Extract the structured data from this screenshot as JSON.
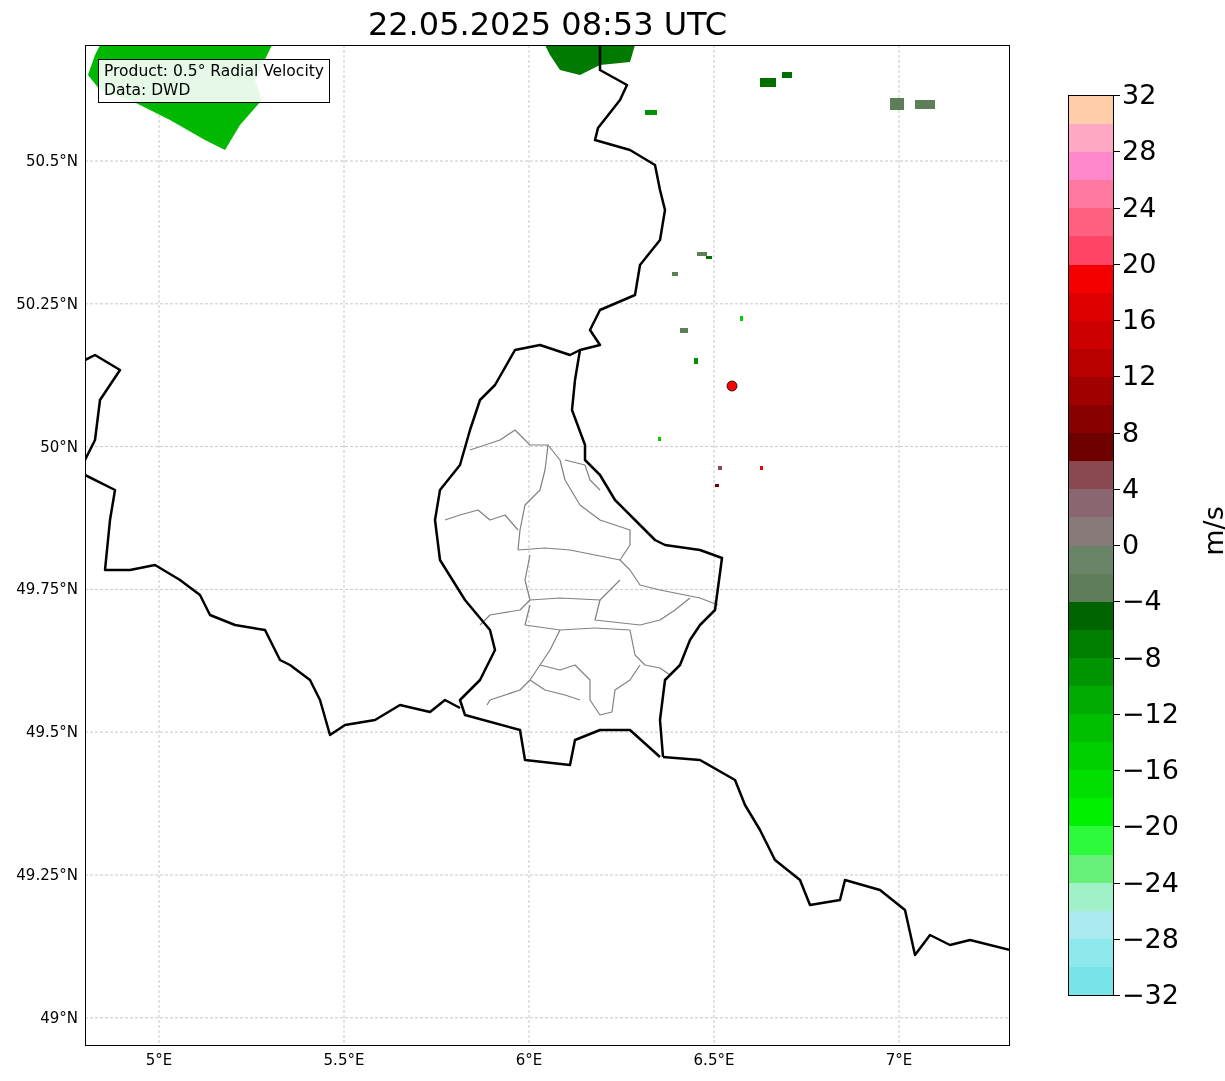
{
  "title": "22.05.2025 08:53 UTC",
  "info_box": {
    "lines": [
      "Product: 0.5° Radial Velocity",
      "Data: DWD"
    ]
  },
  "map": {
    "longitude_ticks": [
      "5°E",
      "5.5°E",
      "6°E",
      "6.5°E",
      "7°E"
    ],
    "latitude_ticks": [
      "50.5°N",
      "50.25°N",
      "50°N",
      "49.75°N",
      "49.5°N",
      "49.25°N",
      "49°N"
    ]
  },
  "colorbar": {
    "label": "m/s",
    "ticks": [
      "32",
      "28",
      "24",
      "20",
      "16",
      "12",
      "8",
      "4",
      "0",
      "−4",
      "−8",
      "−12",
      "−16",
      "−20",
      "−24",
      "−28",
      "−32"
    ],
    "bins": [
      {
        "color": "#ffcdaa"
      },
      {
        "color": "#ffa8c4"
      },
      {
        "color": "#ff88cc"
      },
      {
        "color": "#ff78a0"
      },
      {
        "color": "#ff6080"
      },
      {
        "color": "#ff4466"
      },
      {
        "color": "#f50000"
      },
      {
        "color": "#de0000"
      },
      {
        "color": "#cc0000"
      },
      {
        "color": "#b80000"
      },
      {
        "color": "#a00000"
      },
      {
        "color": "#880000"
      },
      {
        "color": "#6e0000"
      },
      {
        "color": "#8a4850"
      },
      {
        "color": "#8a6670"
      },
      {
        "color": "#887a78"
      },
      {
        "color": "#6a8468"
      },
      {
        "color": "#5e7e5a"
      },
      {
        "color": "#006400"
      },
      {
        "color": "#007e00"
      },
      {
        "color": "#009400"
      },
      {
        "color": "#00aa00"
      },
      {
        "color": "#00bf00"
      },
      {
        "color": "#00d000"
      },
      {
        "color": "#00e000"
      },
      {
        "color": "#00f000"
      },
      {
        "color": "#2cfa3a"
      },
      {
        "color": "#66f07a"
      },
      {
        "color": "#a0f0c8"
      },
      {
        "color": "#aae9ef"
      },
      {
        "color": "#8ee9ec"
      },
      {
        "color": "#78e4e8"
      }
    ]
  }
}
